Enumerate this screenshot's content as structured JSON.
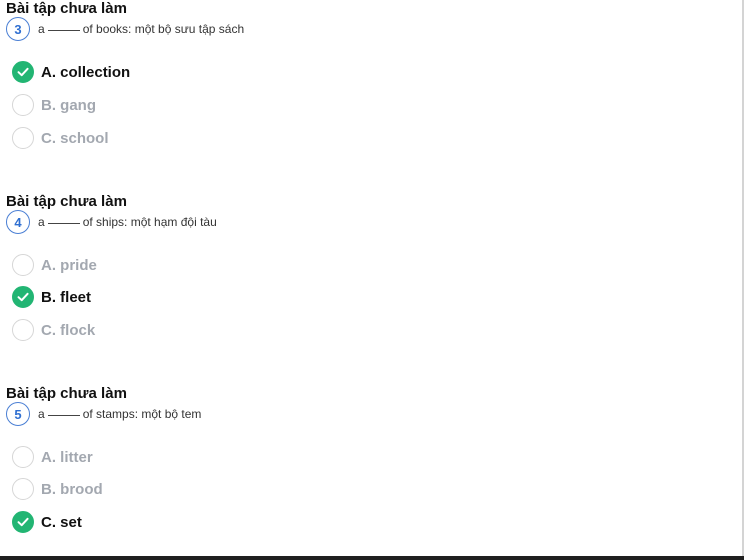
{
  "questions": [
    {
      "heading": "Bài tập chưa làm",
      "number": "3",
      "prefix": "a",
      "suffix": "of books: một bộ sưu tập sách",
      "options": [
        {
          "label": "A. collection",
          "selected": true
        },
        {
          "label": "B. gang",
          "selected": false
        },
        {
          "label": "C. school",
          "selected": false
        }
      ]
    },
    {
      "heading": "Bài tập chưa làm",
      "number": "4",
      "prefix": "a",
      "suffix": "of ships: một hạm đội tàu",
      "options": [
        {
          "label": "A. pride",
          "selected": false
        },
        {
          "label": "B. fleet",
          "selected": true
        },
        {
          "label": "C. flock",
          "selected": false
        }
      ]
    },
    {
      "heading": "Bài tập chưa làm",
      "number": "5",
      "prefix": "a",
      "suffix": "of stamps: một bộ tem",
      "options": [
        {
          "label": "A. litter",
          "selected": false
        },
        {
          "label": "B. brood",
          "selected": false
        },
        {
          "label": "C. set",
          "selected": true
        }
      ]
    }
  ],
  "colors": {
    "check": "#22b573",
    "number_ring": "#4a7fd4",
    "unselected_text": "#a3a8b0"
  },
  "icons": {
    "selected": "check-icon",
    "unselected": "empty-radio-icon"
  }
}
